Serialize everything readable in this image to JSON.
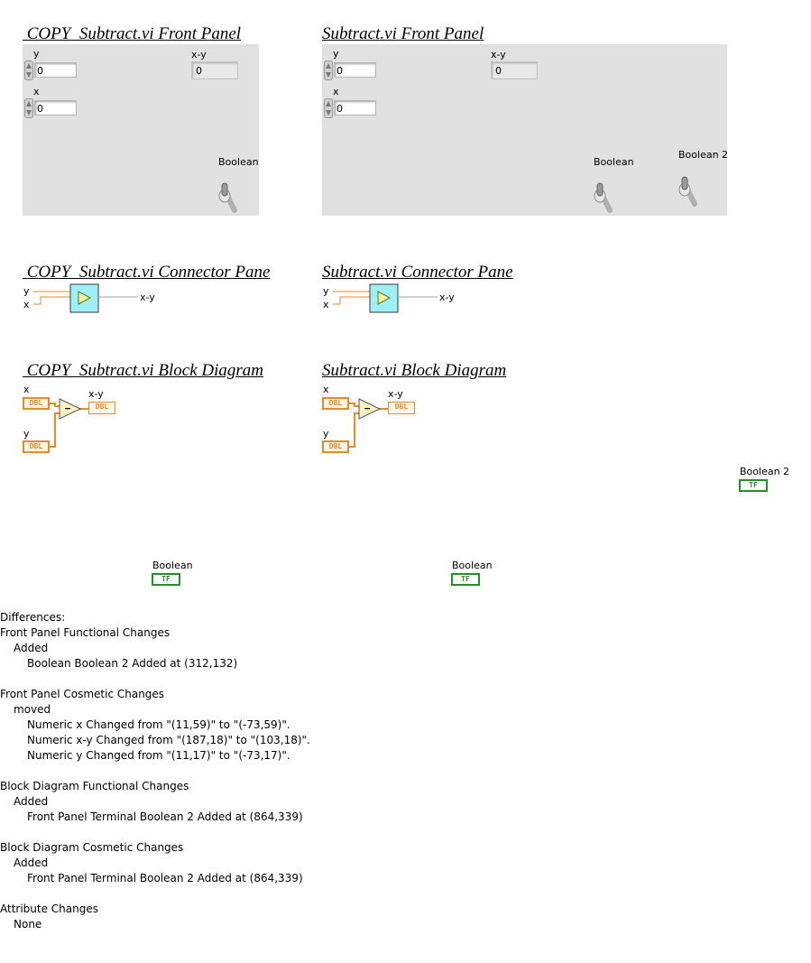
{
  "copy_front_panel": {
    "title": " COPY  Subtract.vi Front Panel",
    "y_label": "y",
    "y_value": "0",
    "x_label": "x",
    "x_value": "0",
    "xy_label": "x-y",
    "xy_value": "0",
    "boolean_label": "Boolean"
  },
  "front_panel": {
    "title": "Subtract.vi Front Panel",
    "y_label": "y",
    "y_value": "0",
    "x_label": "x",
    "x_value": "0",
    "xy_label": "x-y",
    "xy_value": "0",
    "boolean_label": "Boolean",
    "boolean2_label": "Boolean 2"
  },
  "copy_connector": {
    "title": " COPY  Subtract.vi Connector Pane",
    "in_y": "y",
    "in_x": "x",
    "out": "x-y"
  },
  "connector": {
    "title": "Subtract.vi Connector Pane",
    "in_y": "y",
    "in_x": "x",
    "out": "x-y"
  },
  "copy_block": {
    "title": " COPY  Subtract.vi Block Diagram",
    "x_label": "x",
    "y_label": "y",
    "xy_label": "x-y",
    "dbl_text": "DBL",
    "minus": "−",
    "boolean_label": "Boolean",
    "tf_text": "TF"
  },
  "block": {
    "title": "Subtract.vi Block Diagram",
    "x_label": "x",
    "y_label": "y",
    "xy_label": "x-y",
    "dbl_text": "DBL",
    "minus": "−",
    "boolean_label": "Boolean",
    "boolean2_label": "Boolean 2",
    "tf_text": "TF"
  },
  "differences": {
    "heading": "Differences:",
    "fp_functional": "Front Panel Functional Changes",
    "fp_func_added": "Added",
    "fp_func_item1": "Boolean Boolean 2 Added at (312,132)",
    "fp_cosmetic": "Front Panel Cosmetic Changes",
    "fp_cos_moved": "moved",
    "fp_cos_item1": "Numeric x Changed from \"(11,59)\" to \"(-73,59)\".",
    "fp_cos_item2": "Numeric x-y Changed from \"(187,18)\" to \"(103,18)\".",
    "fp_cos_item3": "Numeric y Changed from \"(11,17)\" to \"(-73,17)\".",
    "bd_functional": "Block Diagram Functional Changes",
    "bd_func_added": "Added",
    "bd_func_item1": "Front Panel Terminal Boolean 2 Added at (864,339)",
    "bd_cosmetic": "Block Diagram Cosmetic Changes",
    "bd_cos_added": "Added",
    "bd_cos_item1": "Front Panel Terminal Boolean 2 Added at (864,339)",
    "attr": "Attribute Changes",
    "attr_none": "None"
  },
  "colors": {
    "panel_bg": "#e1e1e1",
    "wire_orange": "#e88a28",
    "bool_green": "#2a8c2a",
    "subvi_cyan": "#9ff0f5"
  },
  "icons": [
    "spinner-arrows-icon",
    "toggle-switch-icon",
    "subtract-node-icon",
    "play-triangle-icon",
    "dbl-terminal-icon",
    "tf-terminal-icon"
  ]
}
